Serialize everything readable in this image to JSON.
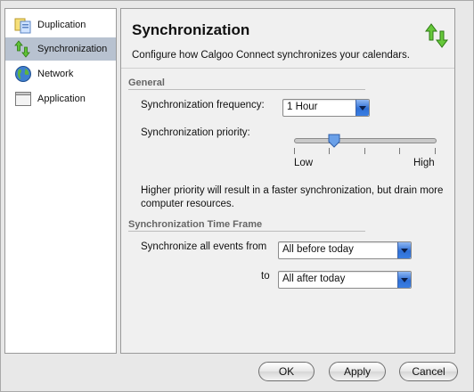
{
  "sidebar": {
    "items": [
      {
        "label": "Duplication",
        "icon": "duplication-icon"
      },
      {
        "label": "Synchronization",
        "icon": "sync-arrows-icon",
        "selected": true
      },
      {
        "label": "Network",
        "icon": "globe-icon"
      },
      {
        "label": "Application",
        "icon": "application-window-icon"
      }
    ]
  },
  "panel": {
    "title": "Synchronization",
    "description": "Configure how Calgoo Connect synchronizes your calendars.",
    "header_icon": "sync-arrows-icon"
  },
  "general": {
    "section_title": "General",
    "frequency_label": "Synchronization frequency:",
    "frequency_value": "1 Hour",
    "priority_label": "Synchronization priority:",
    "priority_low": "Low",
    "priority_high": "High",
    "priority_level": 0.25,
    "note": "Higher priority will result in a faster synchronization, but drain more computer resources."
  },
  "timeframe": {
    "section_title": "Synchronization Time Frame",
    "from_label": "Synchronize all events from",
    "from_value": "All before today",
    "to_label": "to",
    "to_value": "All after today"
  },
  "buttons": {
    "ok": "OK",
    "apply": "Apply",
    "cancel": "Cancel"
  },
  "colors": {
    "selection": "#b8c2d0",
    "accent_green": "#4caf2a",
    "popup_blue": "#2e6fd6"
  }
}
